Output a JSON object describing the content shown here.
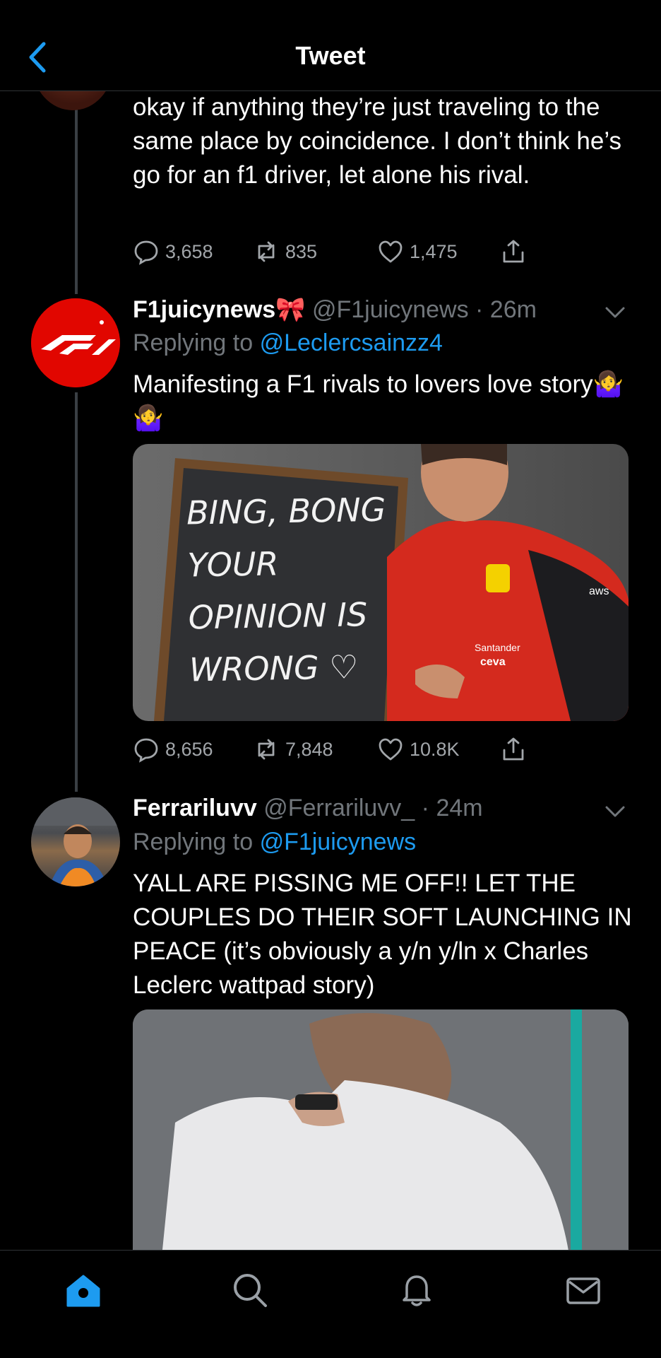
{
  "header": {
    "title": "Tweet",
    "back_icon": "chevron-left-icon"
  },
  "colors": {
    "background": "#000000",
    "link": "#1d9bf0",
    "muted": "#71767b",
    "accent": "#1d9bf0"
  },
  "tweets": [
    {
      "text": "okay if anything they’re just traveling to the same place by coincidence. I don’t think he’s go for an f1 driver, let alone his rival.",
      "stats": {
        "replies": "3,658",
        "retweets": "835",
        "likes": "1,475"
      }
    },
    {
      "name": "F1juicynews🎀",
      "handle": "@F1juicynews",
      "time": "· 26m",
      "replying_label": "Replying to",
      "replying_to": "@Leclercsainzz4",
      "text": "Manifesting a F1 rivals to lovers love story🤷‍♀️🤷‍♀️",
      "media": {
        "board_lines": [
          "BING, BONG",
          "YOUR",
          "OPINION IS",
          "WRONG ♡"
        ],
        "suit_text": [
          "Santander",
          "ceva",
          "aws"
        ]
      },
      "stats": {
        "replies": "8,656",
        "retweets": "7,848",
        "likes": "10.8K"
      }
    },
    {
      "name": "Ferrariluvv",
      "handle": "@Ferrariluvv_",
      "time": "· 24m",
      "replying_label": "Replying to",
      "replying_to": "@F1juicynews",
      "text": "YALL ARE PISSING ME OFF!! LET THE COUPLES DO THEIR SOFT LAUNCHING IN PEACE (it’s obviously a y/n y/ln x Charles Leclerc wattpad story)"
    }
  ],
  "tabbar": {
    "items": [
      {
        "icon": "home-icon",
        "active": true
      },
      {
        "icon": "search-icon",
        "active": false
      },
      {
        "icon": "bell-icon",
        "active": false
      },
      {
        "icon": "mail-icon",
        "active": false
      }
    ]
  }
}
